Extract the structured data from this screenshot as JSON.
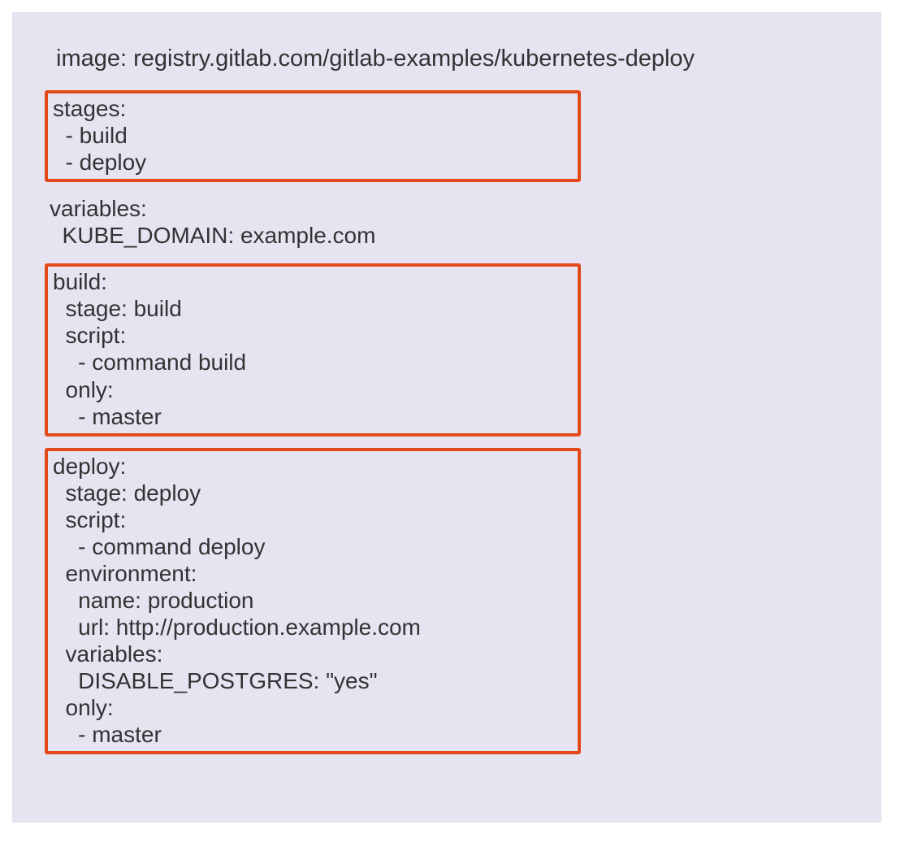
{
  "image_line": "image: registry.gitlab.com/gitlab-examples/kubernetes-deploy",
  "stages_block": "stages:\n  - build\n  - deploy",
  "variables_block": "variables:\n  KUBE_DOMAIN: example.com",
  "build_block": "build:\n  stage: build\n  script:\n    - command build\n  only:\n    - master",
  "deploy_block": "deploy:\n  stage: deploy\n  script:\n    - command deploy\n  environment:\n    name: production\n    url: http://production.example.com\n  variables:\n    DISABLE_POSTGRES: \"yes\"\n  only:\n    - master"
}
